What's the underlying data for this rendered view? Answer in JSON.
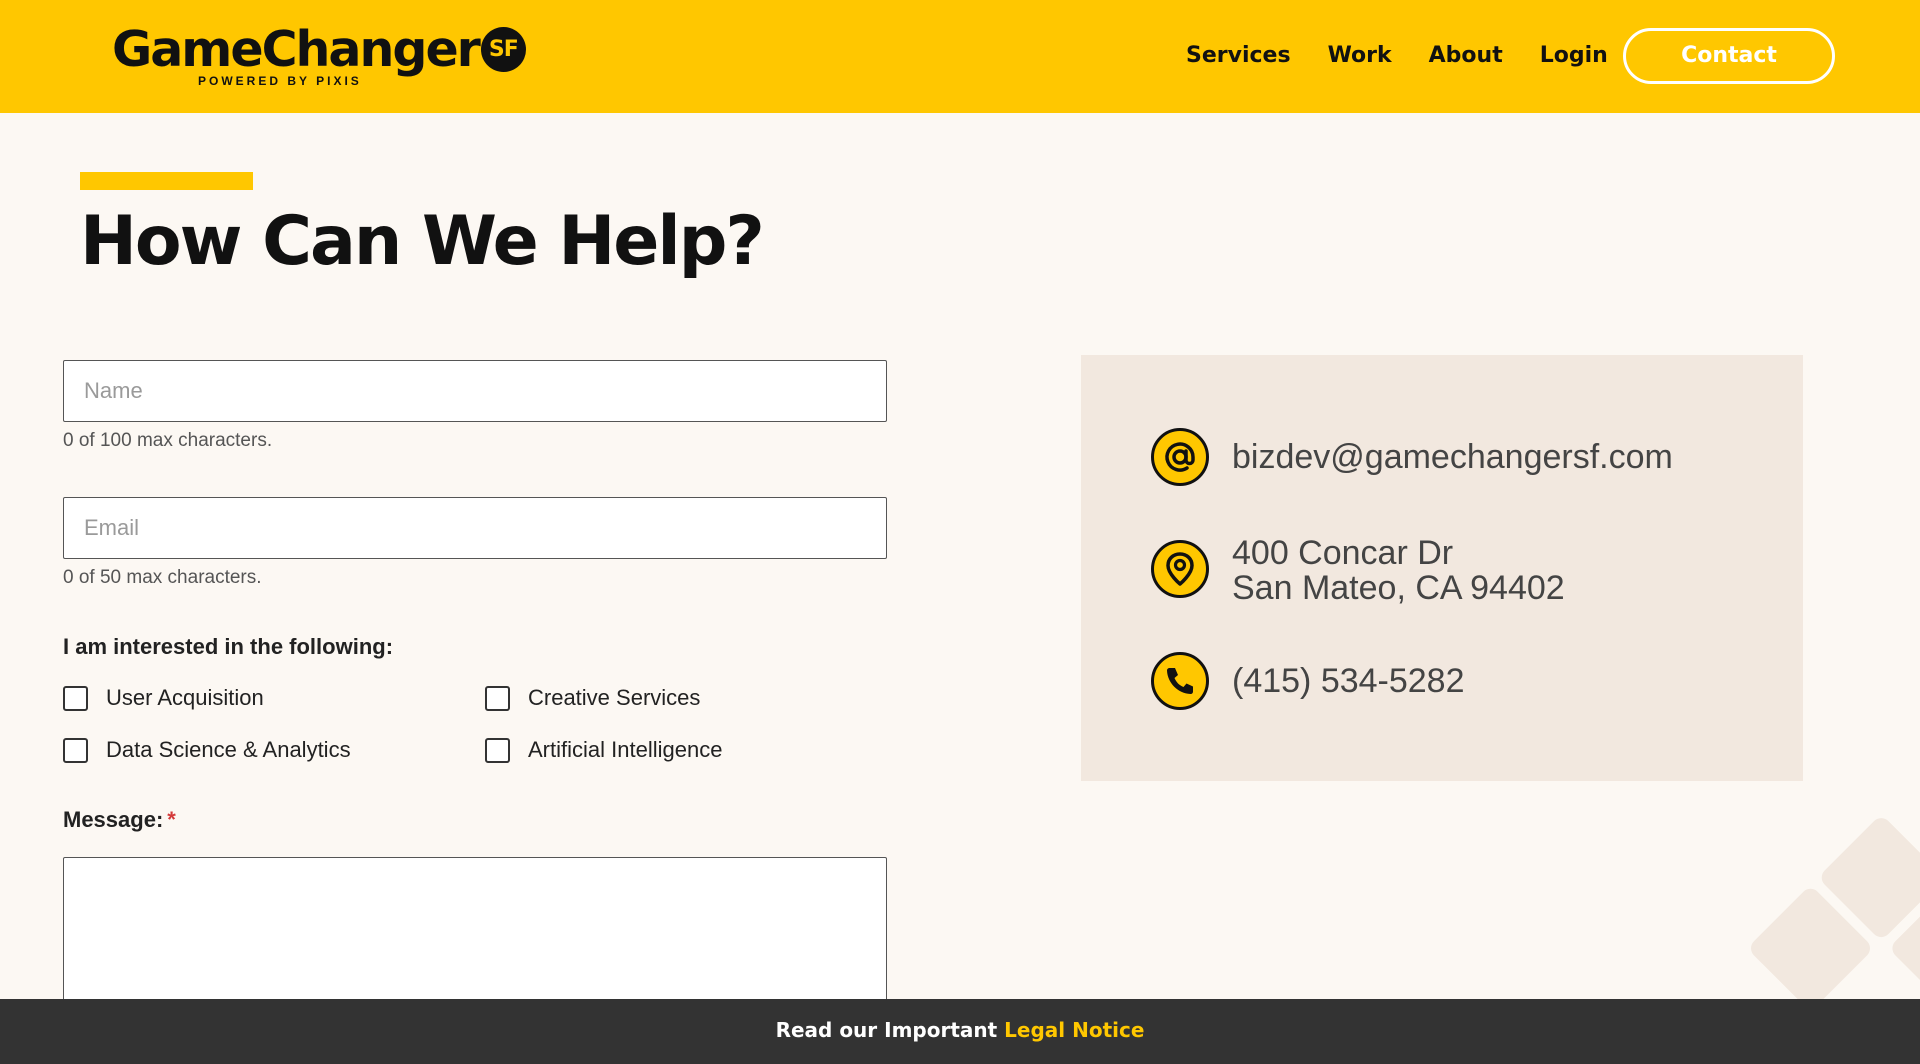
{
  "header": {
    "logo_word": "GameChanger",
    "logo_badge": "SF",
    "logo_tagline": "POWERED BY PIXIS",
    "nav": [
      "Services",
      "Work",
      "About",
      "Login"
    ],
    "contact_label": "Contact"
  },
  "main": {
    "title": "How Can We Help?"
  },
  "form": {
    "name_placeholder": "Name",
    "name_hint": "0 of 100 max characters.",
    "email_placeholder": "Email",
    "email_hint": "0 of 50 max characters.",
    "interest_label": "I am interested in the following:",
    "interests": [
      "User Acquisition",
      "Creative Services",
      "Data Science & Analytics",
      "Artificial Intelligence"
    ],
    "message_label": "Message:",
    "required_mark": "*"
  },
  "contact_info": {
    "email": "bizdev@gamechangersf.com",
    "address_line1": "400 Concar Dr",
    "address_line2": "San Mateo, CA 94402",
    "phone": "(415) 534-5282",
    "icons": [
      "at-icon",
      "location-pin-icon",
      "phone-icon"
    ]
  },
  "legal": {
    "prefix": "Read our Important",
    "link": "Legal Notice"
  },
  "colors": {
    "brand_yellow": "#ffc700",
    "background": "#fcf8f3",
    "card": "#f2e8df",
    "footer": "#333333"
  }
}
